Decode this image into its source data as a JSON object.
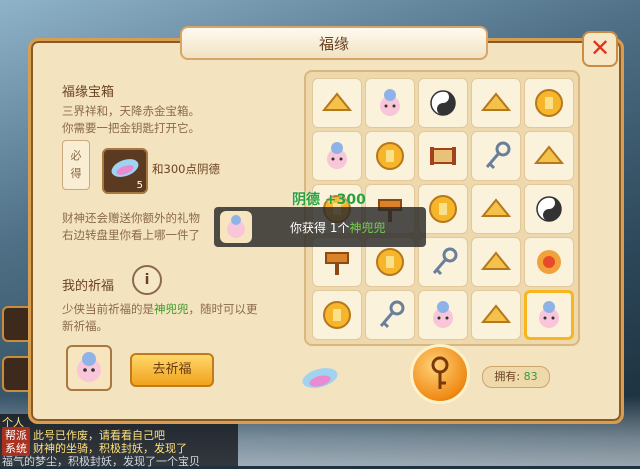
{
  "window": {
    "title": "福缘",
    "close_label": "✕"
  },
  "treasure": {
    "title": "福缘宝箱",
    "desc_line1": "三界祥和，天降赤金宝箱。",
    "desc_line2": "你需要一把金钥匙打开它。",
    "must_label_1": "必",
    "must_label_2": "得",
    "key_count": "5",
    "reward_text": "和300点阴德",
    "gift_line1": "财神还会赠送你额外的礼物",
    "gift_line2": "右边转盘里你看上哪一件了"
  },
  "prayer": {
    "title": "我的祈福",
    "info_label": "i",
    "desc_prefix": "少侠当前祈福的是",
    "current_item": "神兜兜",
    "desc_suffix": "，随时可以更新祈福。",
    "button_label": "去祈福"
  },
  "bonus": {
    "text": "阴德 +300"
  },
  "popup": {
    "text_prefix": "你获得",
    "count": "1个",
    "item_name": "神兜兜"
  },
  "owned": {
    "label": "拥有:",
    "value": "83"
  },
  "grid_items": [
    "gold-ingot-icon",
    "baby-icon",
    "yinyang-icon",
    "gold-ingot-icon",
    "gold-coin-icon",
    "baby-icon",
    "gold-coin-icon",
    "scroll-icon",
    "key-icon",
    "gold-ingot-icon",
    "gold-coin-icon",
    "hammer-icon",
    "gold-coin-icon",
    "gold-ingot-icon",
    "yinyang-icon",
    "hammer-icon",
    "gold-coin-icon",
    "key-icon",
    "gold-ingot-icon",
    "fire-orb-icon",
    "gold-coin-icon",
    "key-icon",
    "baby-icon",
    "gold-ingot-icon",
    "baby-icon"
  ],
  "chat": [
    {
      "tag": "",
      "text": "个人"
    },
    {
      "tag": "帮派",
      "text": "此号已作废，请看看自己吧"
    },
    {
      "tag": "系统",
      "text": "财神的坐骑，积极封妖，发现了"
    },
    {
      "tag": "",
      "text": "福气的梦尘，积极封妖，发现了一个宝贝"
    }
  ],
  "colors": {
    "panel": "#f4e3bf",
    "border": "#d79e52",
    "accent": "#f0a21c",
    "green": "#2aa238"
  }
}
